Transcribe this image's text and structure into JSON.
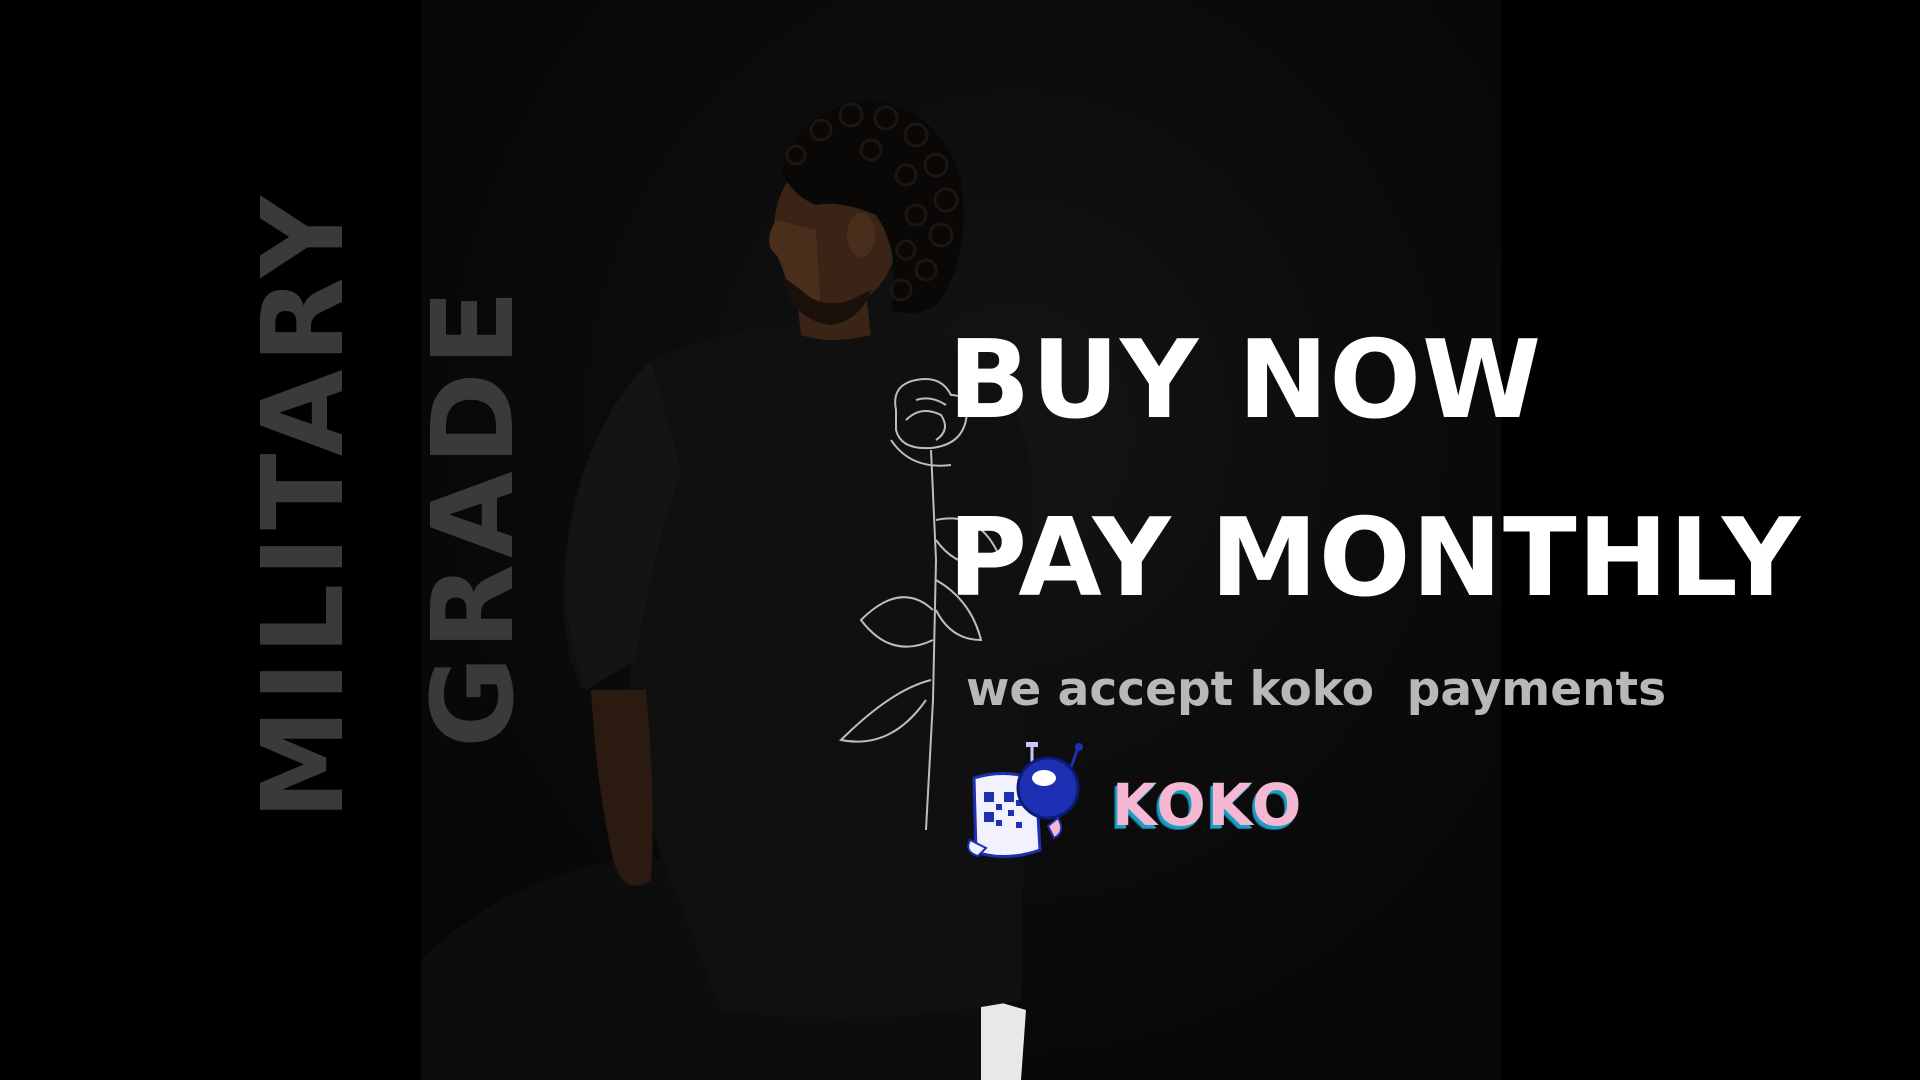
{
  "banner": {
    "vertical_text_1": "MILITARY",
    "vertical_text_2": "GRADE",
    "headline_line_1": "BUY NOW",
    "headline_line_2": "PAY MONTHLY",
    "subline": "we accept koko  payments",
    "logo_text": "KOKO"
  },
  "colors": {
    "background": "#000000",
    "headline": "#ffffff",
    "subline": "#b8b8b8",
    "vertical_text": "#3a3a3a",
    "logo_pink": "#f6b7d2",
    "logo_blue": "#1d2fb3"
  }
}
